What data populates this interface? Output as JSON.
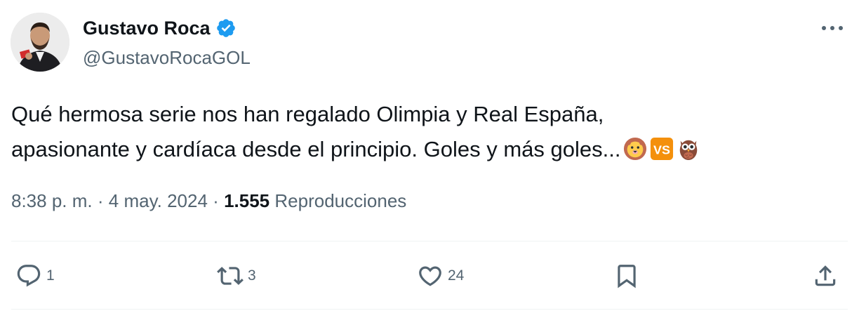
{
  "author": {
    "display_name": "Gustavo Roca",
    "handle": "@GustavoRocaGOL",
    "verified": true
  },
  "tweet": {
    "text_line1": "Qué hermosa serie nos han regalado Olimpia y Real España,",
    "text_line2": "apasionante y cardíaca desde el principio. Goles y más goles...",
    "emojis": [
      "lion-face",
      "vs-button",
      "owl"
    ]
  },
  "meta": {
    "time": "8:38 p. m.",
    "separator": "·",
    "date": "4 may. 2024",
    "views_count": "1.555",
    "views_label": "Reproducciones"
  },
  "actions": {
    "replies": "1",
    "retweets": "3",
    "likes": "24"
  },
  "colors": {
    "text": "#0f1419",
    "secondary": "#536471",
    "verified_blue": "#1d9bf0",
    "divider": "#eff3f4",
    "vs_orange": "#f4900c"
  }
}
